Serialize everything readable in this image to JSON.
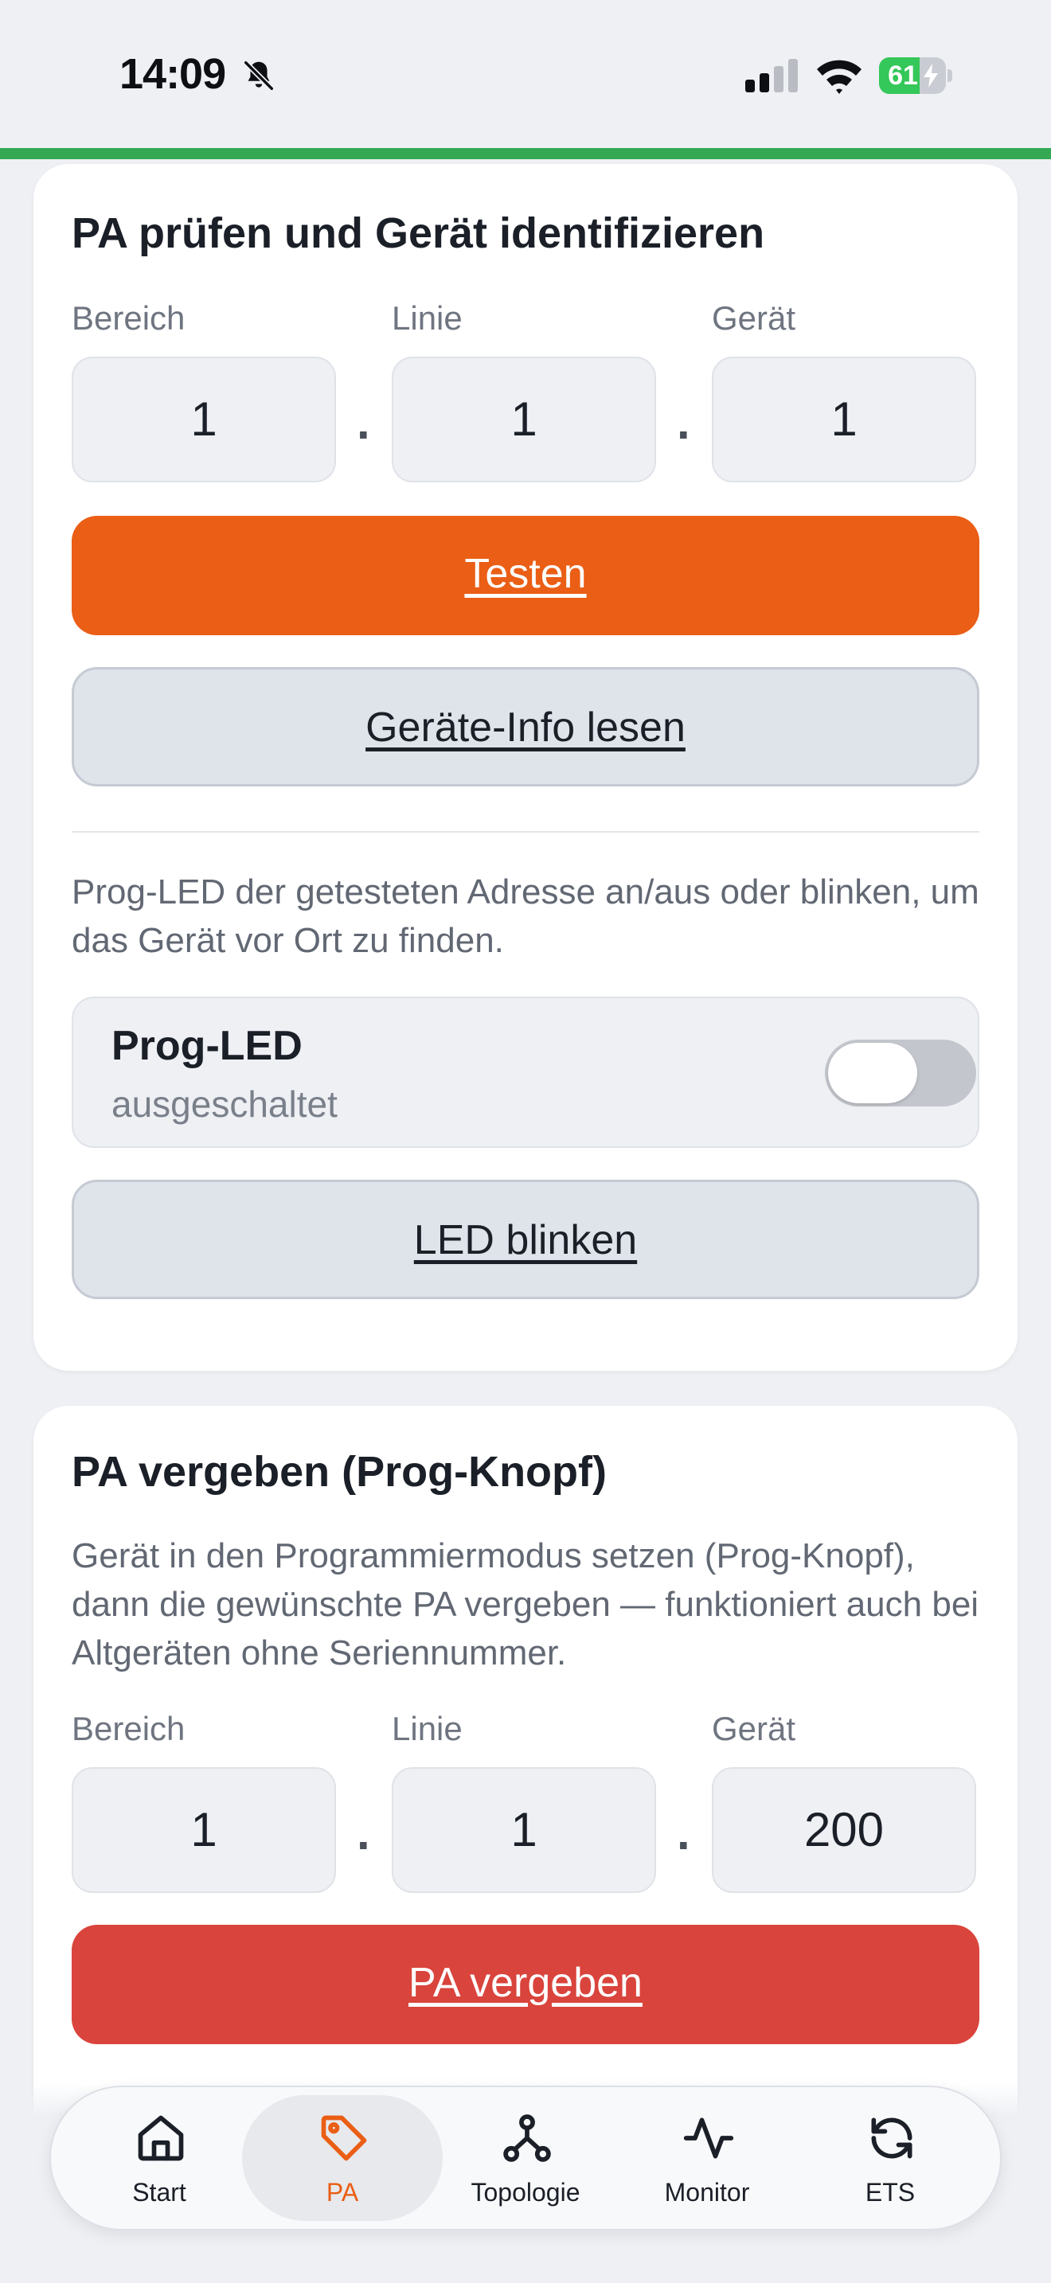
{
  "status_bar": {
    "time": "14:09",
    "battery_level": "61",
    "battery_fraction": 0.61
  },
  "colors": {
    "accent": "#ea5e15",
    "danger": "#d9443c",
    "connected": "#34a853",
    "battery": "#34c759"
  },
  "identify_card": {
    "title": "PA prüfen und Gerät identifizieren",
    "labels": {
      "area": "Bereich",
      "line": "Linie",
      "device": "Gerät"
    },
    "values": {
      "area": "1",
      "line": "1",
      "device": "1"
    },
    "separator": ".",
    "test_button": "Testen",
    "device_info_button": "Geräte-Info lesen",
    "description": "Prog-LED der getesteten Adresse an/aus oder blinken, um das Gerät vor Ort zu finden.",
    "prog_led": {
      "title": "Prog-LED",
      "state": "ausgeschaltet",
      "enabled": false
    },
    "blink_button": "LED blinken"
  },
  "assign_card": {
    "title": "PA vergeben (Prog-Knopf)",
    "description": "Gerät in den Programmiermodus setzen (Prog-Knopf), dann die gewünschte PA vergeben — funktioniert auch bei Altgeräten ohne Seriennummer.",
    "labels": {
      "area": "Bereich",
      "line": "Linie",
      "device": "Gerät"
    },
    "values": {
      "area": "1",
      "line": "1",
      "device": "200"
    },
    "separator": ".",
    "assign_button": "PA vergeben"
  },
  "tab_bar": {
    "tabs": [
      {
        "label": "Start",
        "icon": "home-icon"
      },
      {
        "label": "PA",
        "icon": "tag-icon",
        "active": true
      },
      {
        "label": "Topologie",
        "icon": "topology-icon"
      },
      {
        "label": "Monitor",
        "icon": "pulse-icon"
      },
      {
        "label": "ETS",
        "icon": "sync-icon"
      }
    ]
  }
}
